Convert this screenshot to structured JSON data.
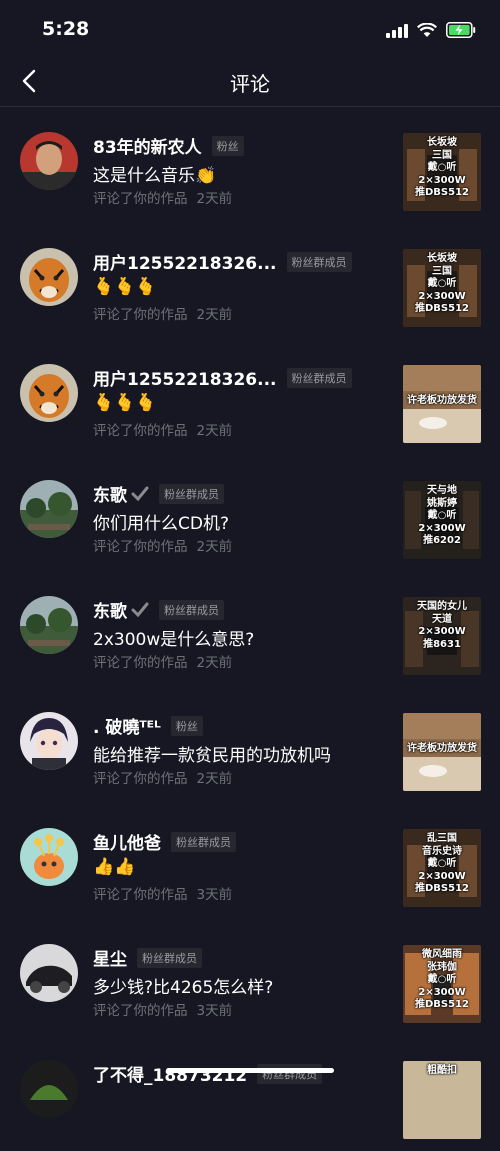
{
  "status_bar": {
    "time": "5:28"
  },
  "header": {
    "title": "评论",
    "back_icon": "chevron-left-icon"
  },
  "colors": {
    "background": "#161722",
    "muted": "#6f707a",
    "badge_bg": "#26272f"
  },
  "comments": [
    {
      "name": "83年的新农人",
      "badge": "粉丝",
      "verified": false,
      "comment": "这是什么音乐👏",
      "action": "评论了你的作品",
      "time": "2天前",
      "thumb_text": "长坂坡\n三国\n戴○听\n2×300W\n推DBS512"
    },
    {
      "name": "用户12552218326...",
      "badge": "粉丝群成员",
      "verified": false,
      "comment": "🫰🫰🫰",
      "action": "评论了你的作品",
      "time": "2天前",
      "thumb_text": "长坂坡\n三国\n戴○听\n2×300W\n推DBS512"
    },
    {
      "name": "用户12552218326...",
      "badge": "粉丝群成员",
      "verified": false,
      "comment": "🫰🫰🫰",
      "action": "评论了你的作品",
      "time": "2天前",
      "thumb_text": "许老板功放发货"
    },
    {
      "name": "东歌",
      "badge": "粉丝群成员",
      "verified": true,
      "comment": "你们用什么CD机?",
      "action": "评论了你的作品",
      "time": "2天前",
      "thumb_text": "天与地\n姚斯婷\n戴○听\n2×300W\n推6202"
    },
    {
      "name": "东歌",
      "badge": "粉丝群成员",
      "verified": true,
      "comment": "2x300w是什么意思?",
      "action": "评论了你的作品",
      "time": "2天前",
      "thumb_text": "天国的女儿\n天道\n2×300W\n推8631"
    },
    {
      "name": ". 破曉ᵀᴱᴸ",
      "badge": "粉丝",
      "verified": false,
      "comment": "能给推荐一款贫民用的功放机吗",
      "action": "评论了你的作品",
      "time": "2天前",
      "thumb_text": "许老板功放发货"
    },
    {
      "name": "鱼儿他爸",
      "badge": "粉丝群成员",
      "verified": false,
      "comment": "👍👍",
      "action": "评论了你的作品",
      "time": "3天前",
      "thumb_text": "乱三国\n音乐史诗\n戴○听\n2×300W\n推DBS512"
    },
    {
      "name": "星尘",
      "badge": "粉丝群成员",
      "verified": false,
      "comment": "多少钱?比4265怎么样?",
      "action": "评论了你的作品",
      "time": "3天前",
      "thumb_text": "微风细雨\n张玮伽\n戴○听\n2×300W\n推DBS512"
    },
    {
      "name": "了不得_18873212",
      "badge": "粉丝群成员",
      "verified": false,
      "comment": "",
      "action": "",
      "time": "",
      "thumb_text": "粗酷扣"
    }
  ]
}
